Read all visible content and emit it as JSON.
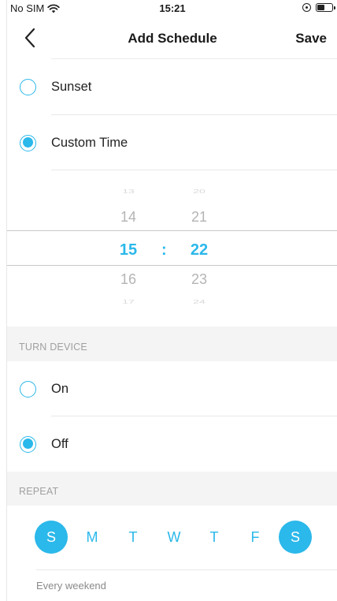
{
  "status_bar": {
    "carrier": "No SIM",
    "time": "15:21"
  },
  "nav": {
    "title": "Add Schedule",
    "save_label": "Save"
  },
  "time_type_options": [
    {
      "label": "Sunset",
      "selected": false
    },
    {
      "label": "Custom Time",
      "selected": true
    }
  ],
  "time_picker": {
    "hours": [
      "13",
      "14",
      "15",
      "16",
      "17"
    ],
    "minutes": [
      "20",
      "21",
      "22",
      "23",
      "24"
    ],
    "separator": ":",
    "selected_hour": "15",
    "selected_minute": "22"
  },
  "turn_device": {
    "header": "TURN DEVICE",
    "options": [
      {
        "label": "On",
        "selected": false
      },
      {
        "label": "Off",
        "selected": true
      }
    ]
  },
  "repeat": {
    "header": "REPEAT",
    "days": [
      {
        "label": "S",
        "selected": true
      },
      {
        "label": "M",
        "selected": false
      },
      {
        "label": "T",
        "selected": false
      },
      {
        "label": "W",
        "selected": false
      },
      {
        "label": "T",
        "selected": false
      },
      {
        "label": "F",
        "selected": false
      },
      {
        "label": "S",
        "selected": true
      }
    ],
    "summary": "Every weekend"
  },
  "colors": {
    "accent": "#2bb8ea",
    "section_background": "#f4f4f4",
    "muted_text": "#a0a0a0"
  }
}
